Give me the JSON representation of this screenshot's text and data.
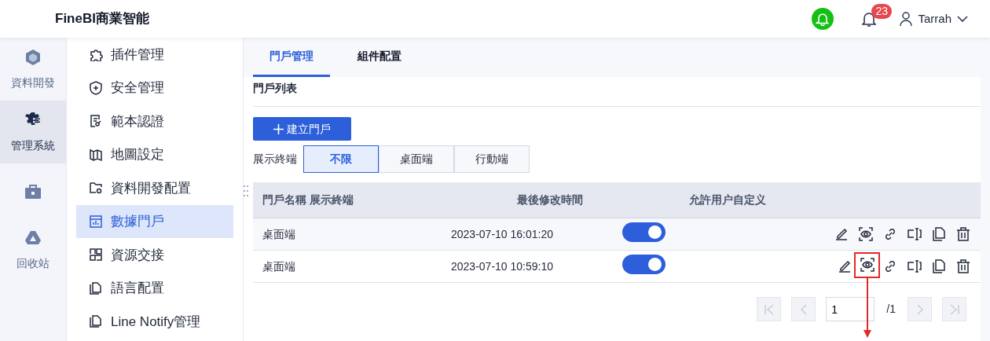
{
  "header": {
    "brand": "FineBI商業智能",
    "badge_count": "23",
    "user": "Tarrah"
  },
  "rail": [
    {
      "kind": "cube",
      "label": "資料開發",
      "selected": false
    },
    {
      "kind": "gear",
      "label": "管理系統",
      "selected": true
    },
    {
      "kind": "toolbox",
      "selected": false
    },
    {
      "kind": "recycle",
      "label": "回收站",
      "selected": false
    }
  ],
  "menu": [
    {
      "kind": "puzzle",
      "label": "插件管理",
      "selected": false
    },
    {
      "kind": "shield",
      "label": "安全管理",
      "selected": false
    },
    {
      "kind": "cert",
      "label": "範本認證",
      "selected": false
    },
    {
      "kind": "map",
      "label": "地圖設定",
      "selected": false
    },
    {
      "kind": "folder",
      "label": "資料開發配置",
      "selected": false
    },
    {
      "kind": "chart",
      "label": "數據門戶",
      "selected": true
    },
    {
      "kind": "blocks",
      "label": "資源交接",
      "selected": false
    },
    {
      "kind": "copy",
      "label": "語言配置",
      "selected": false
    },
    {
      "kind": "copy",
      "label": "Line Notify管理",
      "selected": false
    }
  ],
  "tabs": [
    {
      "label": "門戶管理",
      "selected": true
    },
    {
      "label": "組件配置",
      "selected": false
    }
  ],
  "section_title": "門戶列表",
  "create_button": "建立門戶",
  "filter": {
    "label": "展示終端",
    "options": [
      {
        "label": "不限",
        "selected": true
      },
      {
        "label": "桌面端",
        "selected": false
      },
      {
        "label": "行動端",
        "selected": false
      }
    ]
  },
  "table": {
    "columns": [
      "門戶名稱",
      "展示終端",
      "最後修改時間",
      "允許用户自定义"
    ],
    "rows": [
      {
        "name": "桌面端",
        "modified": "2023-07-10 16:01:20",
        "on": true,
        "actions": [
          {
            "kind": "edit",
            "highlighted": false
          },
          {
            "kind": "preview",
            "highlighted": false
          },
          {
            "kind": "link",
            "highlighted": false
          },
          {
            "kind": "rename",
            "highlighted": false
          },
          {
            "kind": "copy",
            "highlighted": false
          },
          {
            "kind": "delete",
            "highlighted": false
          }
        ]
      },
      {
        "name": "桌面端",
        "modified": "2023-07-10 10:59:10",
        "on": true,
        "actions": [
          {
            "kind": "edit",
            "highlighted": false
          },
          {
            "kind": "preview",
            "highlighted": true
          },
          {
            "kind": "link",
            "highlighted": false
          },
          {
            "kind": "rename",
            "highlighted": false
          },
          {
            "kind": "copy",
            "highlighted": false
          },
          {
            "kind": "delete",
            "highlighted": false
          }
        ]
      }
    ]
  },
  "pagination": {
    "page": "1",
    "total": "/1"
  }
}
